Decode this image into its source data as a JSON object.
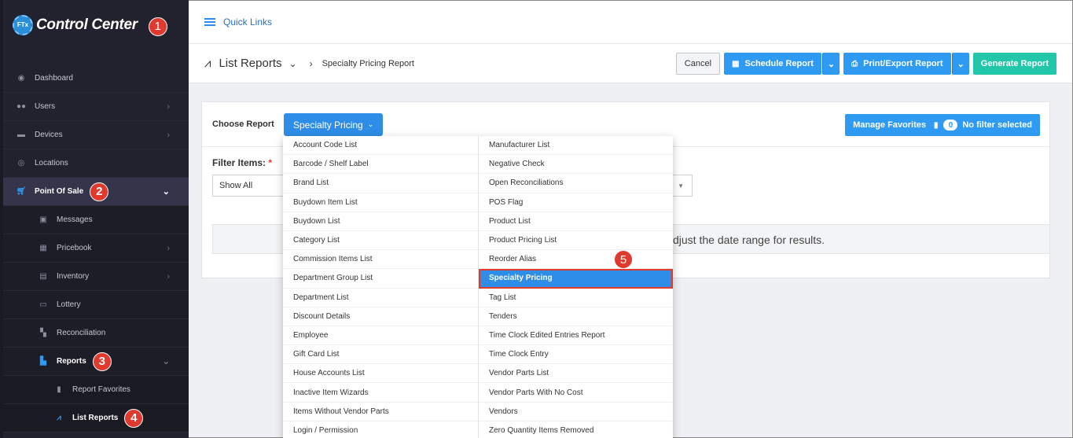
{
  "brand": {
    "logo_text": "FTx",
    "name": "Control Center"
  },
  "steps": [
    "1",
    "2",
    "3",
    "4",
    "5"
  ],
  "sidebar": {
    "items": [
      {
        "label": "Dashboard",
        "icon": "dashboard-icon"
      },
      {
        "label": "Users",
        "icon": "users-icon"
      },
      {
        "label": "Devices",
        "icon": "devices-icon"
      },
      {
        "label": "Locations",
        "icon": "location-pin-icon"
      },
      {
        "label": "Point Of Sale",
        "icon": "cart-icon"
      },
      {
        "label": "Messages",
        "icon": "messages-icon"
      },
      {
        "label": "Pricebook",
        "icon": "pricebook-icon"
      },
      {
        "label": "Inventory",
        "icon": "inventory-icon"
      },
      {
        "label": "Lottery",
        "icon": "lottery-icon"
      },
      {
        "label": "Reconciliation",
        "icon": "reconciliation-icon"
      },
      {
        "label": "Reports",
        "icon": "bar-chart-icon"
      },
      {
        "label": "Report Favorites",
        "icon": "bookmark-icon"
      },
      {
        "label": "List Reports",
        "icon": "line-chart-icon"
      }
    ]
  },
  "quick_links": "Quick Links",
  "header": {
    "title": "List Reports",
    "current": "Specialty Pricing Report",
    "cancel": "Cancel",
    "schedule": "Schedule Report",
    "print": "Print/Export Report",
    "generate": "Generate Report"
  },
  "panel": {
    "choose_label": "Choose Report",
    "selected_report": "Specialty Pricing",
    "manage_favorites": "Manage Favorites",
    "filter_count": "0",
    "filter_status": "No filter selected",
    "filter_items_label": "Filter Items:",
    "required_mark": "*",
    "filter_value": "Show All",
    "message": "djust the date range for results."
  },
  "dropdown": {
    "left": [
      "Account Code List",
      "Barcode / Shelf Label",
      "Brand List",
      "Buydown Item List",
      "Buydown List",
      "Category List",
      "Commission Items List",
      "Department Group List",
      "Department List",
      "Discount Details",
      "Employee",
      "Gift Card List",
      "House Accounts List",
      "Inactive Item Wizards",
      "Items Without Vendor Parts",
      "Login / Permission"
    ],
    "right": [
      "Manufacturer List",
      "Negative Check",
      "Open Reconciliations",
      "POS Flag",
      "Product List",
      "Product Pricing List",
      "Reorder Alias",
      "Specialty Pricing",
      "Tag List",
      "Tenders",
      "Time Clock Edited Entries Report",
      "Time Clock Entry",
      "Vendor Parts List",
      "Vendor Parts With No Cost",
      "Vendors",
      "Zero Quantity Items Removed"
    ]
  },
  "colors": {
    "accent": "#2e8de6",
    "success": "#21c7a8",
    "badge": "#e03a2f",
    "sidebar": "#22222e"
  }
}
